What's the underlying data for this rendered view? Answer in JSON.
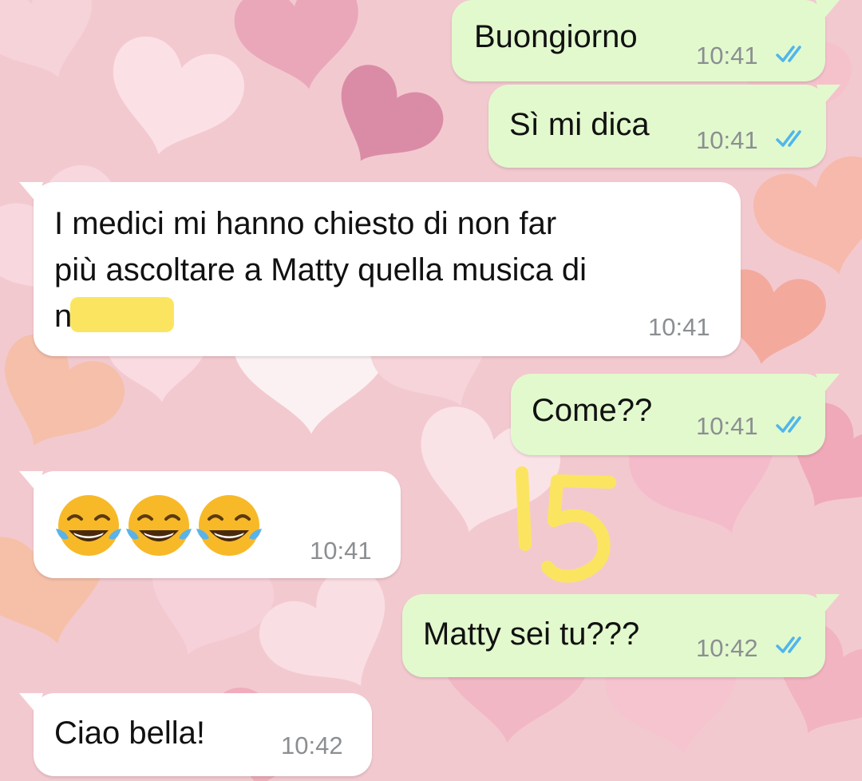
{
  "colors": {
    "outgoing_bubble": "#e2f9cd",
    "incoming_bubble": "#ffffff",
    "read_ticks": "#4fb6ec",
    "time_text": "#8b8f92",
    "redaction": "#fbe560",
    "handwriting": "#fbe560"
  },
  "messages": [
    {
      "direction": "outgoing",
      "text": "Buongiorno",
      "time": "10:41",
      "status": "read"
    },
    {
      "direction": "outgoing",
      "text": "Sì mi dica",
      "time": "10:41",
      "status": "read"
    },
    {
      "direction": "incoming",
      "lines": [
        "I medici mi hanno chiesto di non far",
        "più ascoltare a Matty quella musica di",
        "n"
      ],
      "time": "10:41",
      "redacted": true
    },
    {
      "direction": "outgoing",
      "text": "Come??",
      "time": "10:41",
      "status": "read"
    },
    {
      "direction": "incoming",
      "emoji": [
        "face-with-tears-of-joy",
        "face-with-tears-of-joy",
        "face-with-tears-of-joy"
      ],
      "time": "10:41"
    },
    {
      "direction": "outgoing",
      "text": "Matty sei tu???",
      "time": "10:42",
      "status": "read"
    },
    {
      "direction": "incoming",
      "text": "Ciao bella!",
      "time": "10:42"
    }
  ],
  "annotation": {
    "handwritten_text": "15"
  },
  "icons": {
    "read_receipt": "double-check-icon",
    "wallpaper": "pastel-hearts-wallpaper"
  }
}
